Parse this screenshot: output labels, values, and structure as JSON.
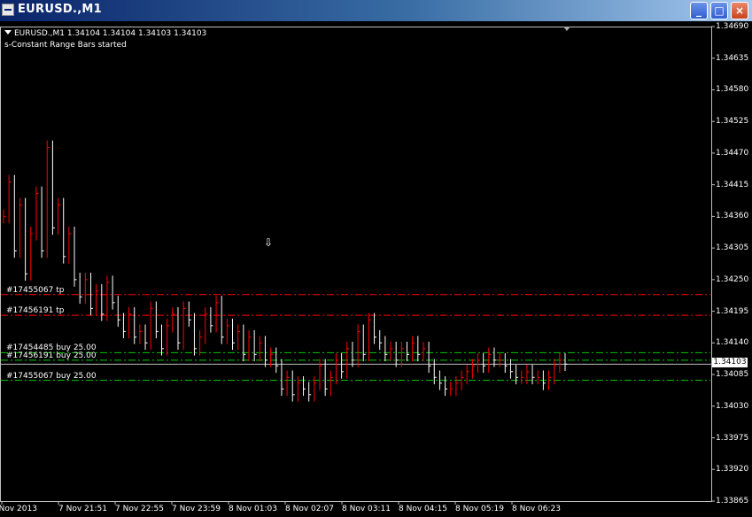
{
  "window": {
    "title": "EURUSD.,M1",
    "minimize_icon": "minimize-icon",
    "maximize_icon": "maximize-icon",
    "close_icon": "close-icon"
  },
  "info": {
    "symbol_line": "EURUSD.,M1  1.34104 1.34104 1.34103 1.34103",
    "indicator_line": "s-Constant Range Bars started"
  },
  "orders": [
    {
      "label": "#17455067 tp",
      "price": 1.34224,
      "color": "#ff0000"
    },
    {
      "label": "#17456191 tp",
      "price": 1.34188,
      "color": "#ff0000"
    },
    {
      "label": "#17454485 buy 25.00",
      "price": 1.34123,
      "color": "#00cc00"
    },
    {
      "label": "#17456191 buy 25.00",
      "price": 1.3411,
      "color": "#00cc00"
    },
    {
      "label": "#17455067 buy 25.00",
      "price": 1.34075,
      "color": "#00cc00"
    }
  ],
  "chart_data": {
    "type": "bar",
    "bid": {
      "price": 1.34103,
      "label": "1.34103"
    },
    "y_ticks": [
      "1.34690",
      "1.34635",
      "1.34580",
      "1.34525",
      "1.34470",
      "1.34415",
      "1.34360",
      "1.34305",
      "1.34250",
      "1.34195",
      "1.34140",
      "1.34085",
      "1.34030",
      "1.33975",
      "1.33920",
      "1.33865"
    ],
    "ylim": [
      1.33865,
      1.3469
    ],
    "x_ticks": [
      "7 Nov 2013",
      "7 Nov 21:51",
      "7 Nov 22:55",
      "7 Nov 23:59",
      "8 Nov 01:03",
      "8 Nov 02:07",
      "8 Nov 03:11",
      "8 Nov 04:15",
      "8 Nov 05:19",
      "8 Nov 06:23"
    ],
    "bar_colors": {
      "up": "#ff0000",
      "down": "#ffffff"
    },
    "closes": [
      1.3436,
      1.3442,
      1.343,
      1.3438,
      1.3426,
      1.3433,
      1.344,
      1.343,
      1.3448,
      1.3434,
      1.3438,
      1.3429,
      1.3433,
      1.3425,
      1.3422,
      1.3425,
      1.342,
      1.3423,
      1.3419,
      1.34245,
      1.3421,
      1.3418,
      1.3416,
      1.3419,
      1.3415,
      1.3416,
      1.3414,
      1.342,
      1.3416,
      1.3413,
      1.3417,
      1.3419,
      1.3414,
      1.342,
      1.3418,
      1.3413,
      1.3415,
      1.3419,
      1.3417,
      1.3421,
      1.3415,
      1.3417,
      1.3414,
      1.3416,
      1.3412,
      1.3415,
      1.3412,
      1.3414,
      1.3411,
      1.3412,
      1.341,
      1.3406,
      1.3408,
      1.3405,
      1.3407,
      1.3406,
      1.3405,
      1.3407,
      1.341,
      1.3406,
      1.3408,
      1.3411,
      1.3409,
      1.3413,
      1.3411,
      1.3416,
      1.3412,
      1.3418,
      1.3415,
      1.3414,
      1.3412,
      1.3413,
      1.3411,
      1.3413,
      1.3412,
      1.3414,
      1.3412,
      1.3413,
      1.341,
      1.3408,
      1.3407,
      1.3406,
      1.3406,
      1.3407,
      1.3408,
      1.3409,
      1.341,
      1.3411,
      1.341,
      1.3412,
      1.3411,
      1.3411,
      1.341,
      1.3409,
      1.3408,
      1.3408,
      1.3409,
      1.3408,
      1.3408,
      1.3407,
      1.3408,
      1.341,
      1.3411,
      1.34103
    ]
  }
}
